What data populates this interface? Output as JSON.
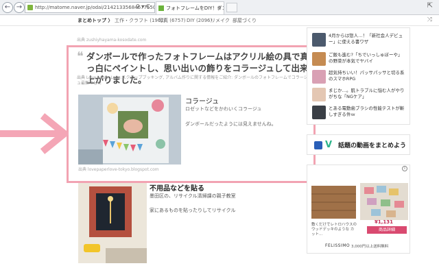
{
  "browser": {
    "url": "http://matome.naver.jp/odai/2142133568467755001",
    "tab_title": "フォトフレームをDIY！ダンボー...",
    "tab_close": "×",
    "addr_controls": "⚲ ▾ C",
    "window_controls": "⇱",
    "back": "←",
    "forward": "→"
  },
  "site_nav": {
    "items": [
      {
        "label": "まとめトップ 〉"
      },
      {
        "label": "工作・クラフト (1962)"
      },
      {
        "label": "写真 (6757)"
      },
      {
        "label": "DIY (2096)"
      },
      {
        "label": "リメイク"
      },
      {
        "label": "部屋づくり"
      }
    ],
    "shuffle": "⤨"
  },
  "article": {
    "source_top": "出典 zushiyhayama-kosodate.com",
    "quote_mark": "❝",
    "quote": "ダンボールで作ったフォトフレームはアクリル絵の具で真っ白にペイントし、思い出いの飾りをコラージュして出来上がりました。",
    "quote_source": "出典 Love paper Love:スクラップブッキング, アルバム作りに関する情報をご紹介: ダンボールのフォトフレームでコラージュ最新でした",
    "item1": {
      "title": "コラージュ",
      "subtitle": "ロゼットなどをかわいくコラージュ",
      "note": "ダンボールだったようには見えませんね。",
      "photo_source": "出典 lovepaperlove-tokyo.blogspot.com"
    },
    "item2": {
      "title": "不用品などを貼る",
      "subtitle": "墨田区の、リサイクル清掃課の親子教室",
      "note": "家にあるものを貼ったりしてリサイクル"
    }
  },
  "sidebar": {
    "items": [
      {
        "text": "4月からは惣人…！「新社会人デビュー」に使える書ワザ"
      },
      {
        "text": "ご飯も進む?「ちでいっしゅぼーや」の野菜が本気でヤバイ"
      },
      {
        "text": "超気持ちいい！パッサパッサと切る系のスマホRPG"
      },
      {
        "text": "まじか…。肌トラブルに悩む人がやりがちな「NGケア」"
      },
      {
        "text": "とある電動歯ブラシの性能テストが斬しすぎる件ｗ"
      }
    ],
    "video_label": "話題の動画をまとめよう",
    "vine_glyph": "V"
  },
  "ad": {
    "info": "i",
    "caption": "敷くだけでレトロハウスのウッドデッキのような カット...",
    "price": "¥1,131",
    "cta": "商品詳細",
    "brand": "FELISSIMO",
    "brand_tag": "3,000円以上送料無料"
  },
  "colors": {
    "highlight": "#f2a3b2",
    "arrow": "#f4a6b6",
    "ad_cta": "#d94a70"
  }
}
